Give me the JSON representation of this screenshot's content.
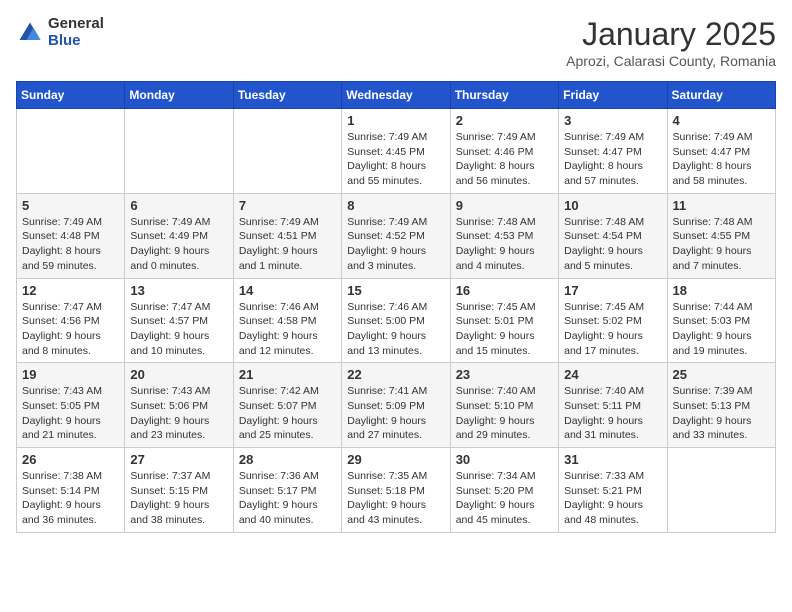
{
  "logo": {
    "general": "General",
    "blue": "Blue"
  },
  "title": "January 2025",
  "location": "Aprozi, Calarasi County, Romania",
  "weekdays": [
    "Sunday",
    "Monday",
    "Tuesday",
    "Wednesday",
    "Thursday",
    "Friday",
    "Saturday"
  ],
  "weeks": [
    [
      {
        "day": "",
        "info": ""
      },
      {
        "day": "",
        "info": ""
      },
      {
        "day": "",
        "info": ""
      },
      {
        "day": "1",
        "info": "Sunrise: 7:49 AM\nSunset: 4:45 PM\nDaylight: 8 hours\nand 55 minutes."
      },
      {
        "day": "2",
        "info": "Sunrise: 7:49 AM\nSunset: 4:46 PM\nDaylight: 8 hours\nand 56 minutes."
      },
      {
        "day": "3",
        "info": "Sunrise: 7:49 AM\nSunset: 4:47 PM\nDaylight: 8 hours\nand 57 minutes."
      },
      {
        "day": "4",
        "info": "Sunrise: 7:49 AM\nSunset: 4:47 PM\nDaylight: 8 hours\nand 58 minutes."
      }
    ],
    [
      {
        "day": "5",
        "info": "Sunrise: 7:49 AM\nSunset: 4:48 PM\nDaylight: 8 hours\nand 59 minutes."
      },
      {
        "day": "6",
        "info": "Sunrise: 7:49 AM\nSunset: 4:49 PM\nDaylight: 9 hours\nand 0 minutes."
      },
      {
        "day": "7",
        "info": "Sunrise: 7:49 AM\nSunset: 4:51 PM\nDaylight: 9 hours\nand 1 minute."
      },
      {
        "day": "8",
        "info": "Sunrise: 7:49 AM\nSunset: 4:52 PM\nDaylight: 9 hours\nand 3 minutes."
      },
      {
        "day": "9",
        "info": "Sunrise: 7:48 AM\nSunset: 4:53 PM\nDaylight: 9 hours\nand 4 minutes."
      },
      {
        "day": "10",
        "info": "Sunrise: 7:48 AM\nSunset: 4:54 PM\nDaylight: 9 hours\nand 5 minutes."
      },
      {
        "day": "11",
        "info": "Sunrise: 7:48 AM\nSunset: 4:55 PM\nDaylight: 9 hours\nand 7 minutes."
      }
    ],
    [
      {
        "day": "12",
        "info": "Sunrise: 7:47 AM\nSunset: 4:56 PM\nDaylight: 9 hours\nand 8 minutes."
      },
      {
        "day": "13",
        "info": "Sunrise: 7:47 AM\nSunset: 4:57 PM\nDaylight: 9 hours\nand 10 minutes."
      },
      {
        "day": "14",
        "info": "Sunrise: 7:46 AM\nSunset: 4:58 PM\nDaylight: 9 hours\nand 12 minutes."
      },
      {
        "day": "15",
        "info": "Sunrise: 7:46 AM\nSunset: 5:00 PM\nDaylight: 9 hours\nand 13 minutes."
      },
      {
        "day": "16",
        "info": "Sunrise: 7:45 AM\nSunset: 5:01 PM\nDaylight: 9 hours\nand 15 minutes."
      },
      {
        "day": "17",
        "info": "Sunrise: 7:45 AM\nSunset: 5:02 PM\nDaylight: 9 hours\nand 17 minutes."
      },
      {
        "day": "18",
        "info": "Sunrise: 7:44 AM\nSunset: 5:03 PM\nDaylight: 9 hours\nand 19 minutes."
      }
    ],
    [
      {
        "day": "19",
        "info": "Sunrise: 7:43 AM\nSunset: 5:05 PM\nDaylight: 9 hours\nand 21 minutes."
      },
      {
        "day": "20",
        "info": "Sunrise: 7:43 AM\nSunset: 5:06 PM\nDaylight: 9 hours\nand 23 minutes."
      },
      {
        "day": "21",
        "info": "Sunrise: 7:42 AM\nSunset: 5:07 PM\nDaylight: 9 hours\nand 25 minutes."
      },
      {
        "day": "22",
        "info": "Sunrise: 7:41 AM\nSunset: 5:09 PM\nDaylight: 9 hours\nand 27 minutes."
      },
      {
        "day": "23",
        "info": "Sunrise: 7:40 AM\nSunset: 5:10 PM\nDaylight: 9 hours\nand 29 minutes."
      },
      {
        "day": "24",
        "info": "Sunrise: 7:40 AM\nSunset: 5:11 PM\nDaylight: 9 hours\nand 31 minutes."
      },
      {
        "day": "25",
        "info": "Sunrise: 7:39 AM\nSunset: 5:13 PM\nDaylight: 9 hours\nand 33 minutes."
      }
    ],
    [
      {
        "day": "26",
        "info": "Sunrise: 7:38 AM\nSunset: 5:14 PM\nDaylight: 9 hours\nand 36 minutes."
      },
      {
        "day": "27",
        "info": "Sunrise: 7:37 AM\nSunset: 5:15 PM\nDaylight: 9 hours\nand 38 minutes."
      },
      {
        "day": "28",
        "info": "Sunrise: 7:36 AM\nSunset: 5:17 PM\nDaylight: 9 hours\nand 40 minutes."
      },
      {
        "day": "29",
        "info": "Sunrise: 7:35 AM\nSunset: 5:18 PM\nDaylight: 9 hours\nand 43 minutes."
      },
      {
        "day": "30",
        "info": "Sunrise: 7:34 AM\nSunset: 5:20 PM\nDaylight: 9 hours\nand 45 minutes."
      },
      {
        "day": "31",
        "info": "Sunrise: 7:33 AM\nSunset: 5:21 PM\nDaylight: 9 hours\nand 48 minutes."
      },
      {
        "day": "",
        "info": ""
      }
    ]
  ]
}
